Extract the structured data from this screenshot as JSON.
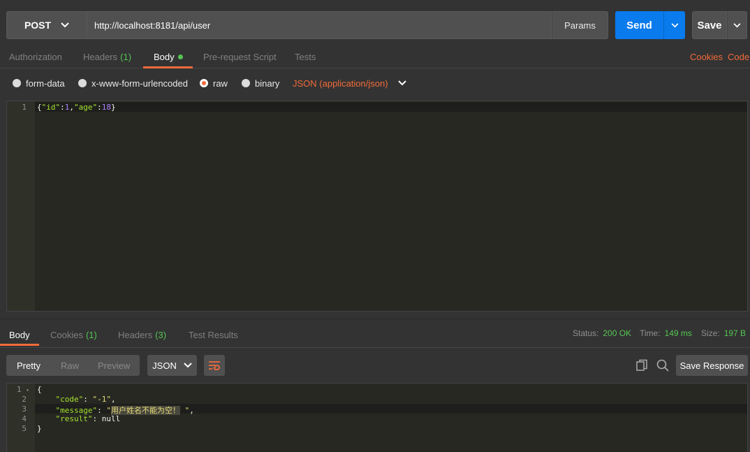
{
  "request": {
    "method": "POST",
    "url": "http://localhost:8181/api/user",
    "params_label": "Params",
    "send_label": "Send",
    "save_label": "Save"
  },
  "request_tabs": {
    "authorization": "Authorization",
    "headers": "Headers",
    "headers_count": "(1)",
    "body": "Body",
    "pre_request": "Pre-request Script",
    "tests": "Tests",
    "cookies": "Cookies",
    "code": "Code"
  },
  "body_types": {
    "form_data": "form-data",
    "urlencoded": "x-www-form-urlencoded",
    "raw": "raw",
    "binary": "binary",
    "content_type": "JSON (application/json)"
  },
  "request_body": {
    "line_no": "1",
    "text_parts": [
      "{",
      "\"id\"",
      ":",
      "1",
      ",",
      "\"age\"",
      ":",
      "18",
      "}"
    ]
  },
  "response_tabs": {
    "body": "Body",
    "cookies": "Cookies",
    "cookies_count": "(1)",
    "headers": "Headers",
    "headers_count": "(3)",
    "test_results": "Test Results"
  },
  "status": {
    "status_label": "Status:",
    "status_value": "200 OK",
    "time_label": "Time:",
    "time_value": "149 ms",
    "size_label": "Size:",
    "size_value": "197 B"
  },
  "response_toolbar": {
    "pretty": "Pretty",
    "raw": "Raw",
    "preview": "Preview",
    "format": "JSON",
    "save_response": "Save Response"
  },
  "response_body": {
    "line_numbers": [
      "1",
      "2",
      "3",
      "4",
      "5"
    ],
    "open_brace": "{",
    "code_key": "\"code\"",
    "code_val": "\"-1\"",
    "message_key": "\"message\"",
    "message_val": "用户姓名不能为空！",
    "result_key": "\"result\"",
    "result_val": "null",
    "close_brace": "}"
  },
  "colors": {
    "accent": "#f26b3a",
    "send": "#097bed",
    "success": "#55c553"
  }
}
